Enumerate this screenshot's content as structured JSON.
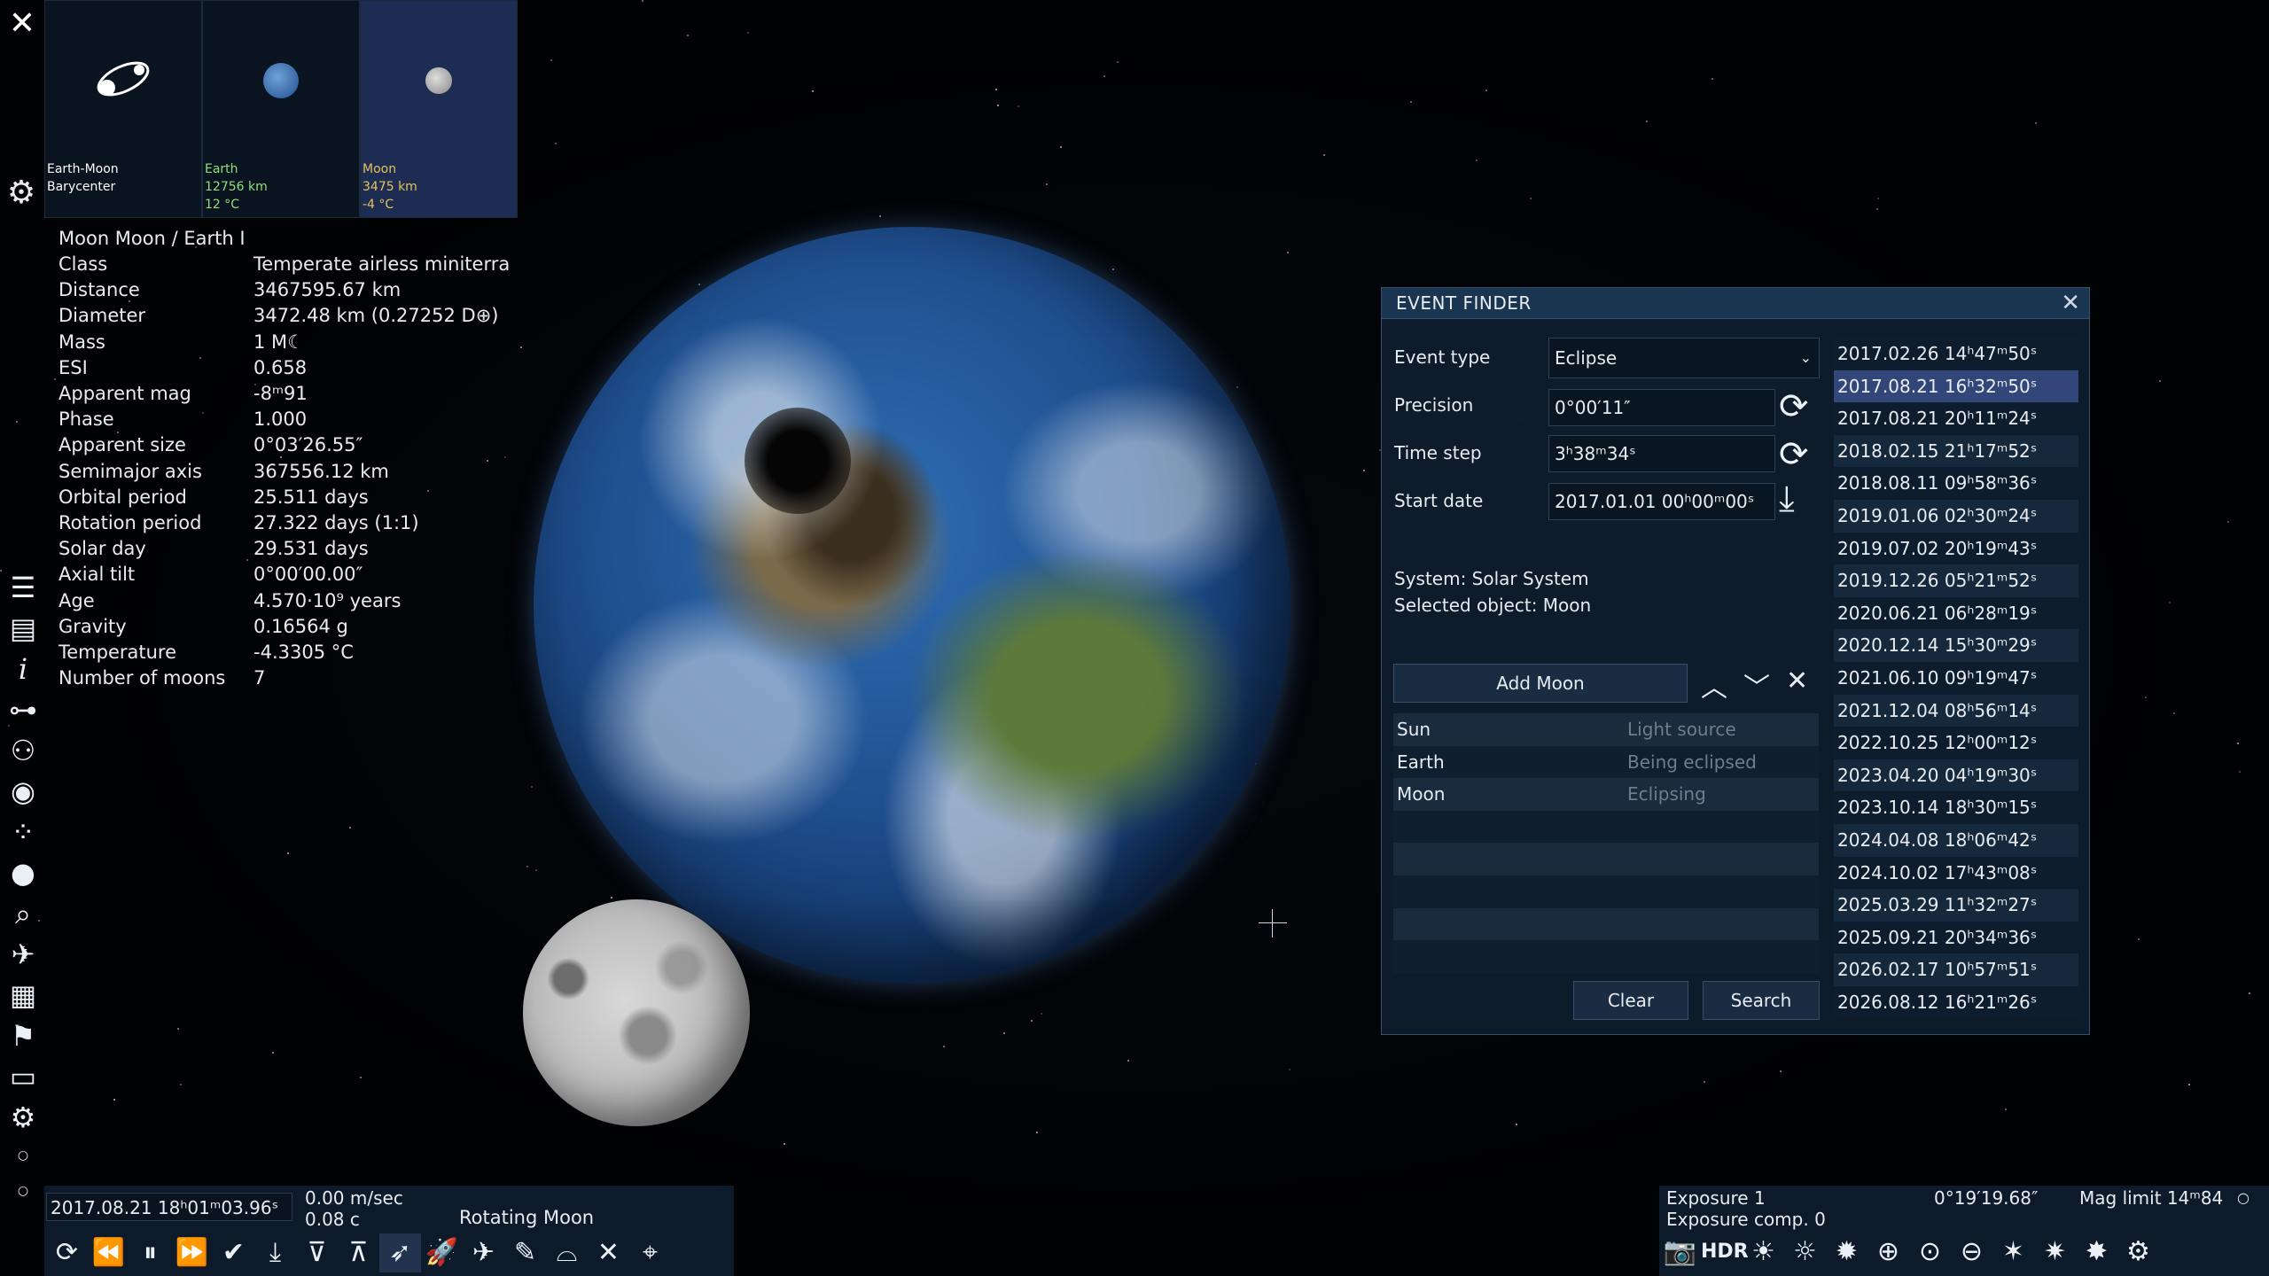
{
  "bodies": [
    {
      "name": "Earth-Moon Barycenter",
      "line1": "Earth-Moon",
      "line2": "Barycenter",
      "line3": "",
      "color": "#ffffff"
    },
    {
      "name": "Earth",
      "line1": "Earth",
      "line2": "12756 km",
      "line3": "12 °C",
      "color": "#8fe07a"
    },
    {
      "name": "Moon",
      "line1": "Moon",
      "line2": "3475 km",
      "line3": "-4 °C",
      "color": "#e6c35a"
    }
  ],
  "info": {
    "header": "Moon  Moon / Earth I",
    "rows": [
      {
        "k": "Class",
        "v": "Temperate airless miniterra"
      },
      {
        "k": "Distance",
        "v": "3467595.67 km"
      },
      {
        "k": "Diameter",
        "v": "3472.48 km (0.27252 D⊕)"
      },
      {
        "k": "Mass",
        "v": "1 M☾"
      },
      {
        "k": "ESI",
        "v": "0.658"
      },
      {
        "k": "Apparent mag",
        "v": "-8ᵐ91"
      },
      {
        "k": "Phase",
        "v": "1.000"
      },
      {
        "k": "Apparent size",
        "v": "0°03′26.55″"
      },
      {
        "k": "Semimajor axis",
        "v": "367556.12 km"
      },
      {
        "k": "Orbital period",
        "v": "25.511 days"
      },
      {
        "k": "Rotation period",
        "v": "27.322 days (1:1)"
      },
      {
        "k": "Solar day",
        "v": "29.531 days"
      },
      {
        "k": "Axial tilt",
        "v": "0°00′00.00″"
      },
      {
        "k": "Age",
        "v": "4.570·10⁹ years"
      },
      {
        "k": "Gravity",
        "v": "0.16564 g"
      },
      {
        "k": "Temperature",
        "v": "-4.3305 °C"
      },
      {
        "k": "Number of moons",
        "v": "7"
      }
    ]
  },
  "bottom_left": {
    "date": "2017.08.21 18ʰ01ᵐ03.96ˢ",
    "speed": "0.00 m/sec",
    "speed_c": "0.08 c",
    "mode": "Rotating Moon"
  },
  "bottom_right": {
    "exposure": "Exposure 1",
    "exposure_comp": "Exposure comp. 0",
    "fov": "0°19′19.68″",
    "mag_limit": "Mag limit 14ᵐ84",
    "hdr": "HDR"
  },
  "event_finder": {
    "title": "EVENT FINDER",
    "event_type_label": "Event type",
    "event_type_value": "Eclipse",
    "precision_label": "Precision",
    "precision_value": "0°00′11″",
    "time_step_label": "Time step",
    "time_step_value": "3ʰ38ᵐ34ˢ",
    "start_date_label": "Start date",
    "start_date_value": "2017.01.01 00ʰ00ᵐ00ˢ",
    "system": "System: Solar System",
    "selected": "Selected object: Moon",
    "add_label": "Add Moon",
    "roles": [
      {
        "obj": "Sun",
        "role": "Light source"
      },
      {
        "obj": "Earth",
        "role": "Being eclipsed"
      },
      {
        "obj": "Moon",
        "role": "Eclipsing"
      },
      {
        "obj": "",
        "role": ""
      },
      {
        "obj": "",
        "role": ""
      },
      {
        "obj": "",
        "role": ""
      },
      {
        "obj": "",
        "role": ""
      },
      {
        "obj": "",
        "role": ""
      }
    ],
    "clear_label": "Clear",
    "search_label": "Search",
    "results": [
      "2017.02.26 14ʰ47ᵐ50ˢ",
      "2017.08.21 16ʰ32ᵐ50ˢ",
      "2017.08.21 20ʰ11ᵐ24ˢ",
      "2018.02.15 21ʰ17ᵐ52ˢ",
      "2018.08.11 09ʰ58ᵐ36ˢ",
      "2019.01.06 02ʰ30ᵐ24ˢ",
      "2019.07.02 20ʰ19ᵐ43ˢ",
      "2019.12.26 05ʰ21ᵐ52ˢ",
      "2020.06.21 06ʰ28ᵐ19ˢ",
      "2020.12.14 15ʰ30ᵐ29ˢ",
      "2021.06.10 09ʰ19ᵐ47ˢ",
      "2021.12.04 08ʰ56ᵐ14ˢ",
      "2022.10.25 12ʰ00ᵐ12ˢ",
      "2023.04.20 04ʰ19ᵐ30ˢ",
      "2023.10.14 18ʰ30ᵐ15ˢ",
      "2024.04.08 18ʰ06ᵐ42ˢ",
      "2024.10.02 17ʰ43ᵐ08ˢ",
      "2025.03.29 11ʰ32ᵐ27ˢ",
      "2025.09.21 20ʰ34ᵐ36ˢ",
      "2026.02.17 10ʰ57ᵐ51ˢ",
      "2026.08.12 16ʰ21ᵐ26ˢ"
    ],
    "selected_result_index": 1
  }
}
